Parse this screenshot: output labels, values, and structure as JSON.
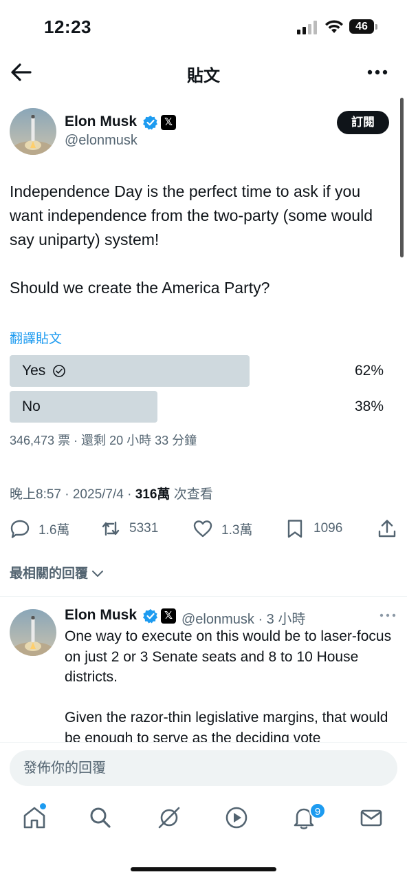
{
  "status_bar": {
    "time": "12:23",
    "battery": "46"
  },
  "header": {
    "title": "貼文"
  },
  "post": {
    "author_name": "Elon Musk",
    "x_badge": "𝕏",
    "handle": "@elonmusk",
    "subscribe_label": "訂閱",
    "text": "Independence Day is the perfect time to ask if you want independence from the two-party (some would say uniparty) system!\n\nShould we create the America Party?",
    "translate_label": "翻譯貼文",
    "poll": {
      "options": [
        {
          "label": "Yes",
          "percent_text": "62%",
          "percent": 62,
          "selected": true
        },
        {
          "label": "No",
          "percent_text": "38%",
          "percent": 38,
          "selected": false
        }
      ],
      "meta": "346,473 票 · 還剩 20 小時 33 分鐘"
    },
    "timestamp": "晚上8:57 · 2025/7/4 · ",
    "views": "316萬",
    "views_suffix": " 次查看",
    "actions": {
      "replies": "1.6萬",
      "reposts": "5331",
      "likes": "1.3萬",
      "bookmarks": "1096"
    }
  },
  "sort_label": "最相關的回覆",
  "reply": {
    "author_name": "Elon Musk",
    "x_badge": "𝕏",
    "handle_time": "@elonmusk · 3 小時",
    "text": "One way to execute on this would be to laser-focus on just 2 or 3 Senate seats and 8 to 10 House districts.\n\nGiven the razor-thin legislative margins, that would be enough to serve as the deciding vote"
  },
  "reply_input": {
    "placeholder": "發佈你的回覆"
  },
  "tabbar": {
    "notification_count": "9"
  },
  "colors": {
    "accent": "#1d9bf0",
    "poll_bar": "#cfd9de",
    "secondary_text": "#536471"
  }
}
